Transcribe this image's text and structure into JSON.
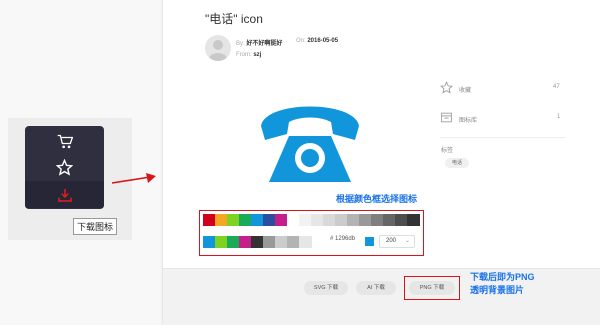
{
  "left": {
    "download_label": "下载图标"
  },
  "icon": {
    "title": "\"电话\" icon",
    "by_label": "By:",
    "author": "好不好啊挺好",
    "on_label": "On:",
    "date": "2016-05-05",
    "from_label": "From:",
    "from_value": "szj",
    "color": "#1296db"
  },
  "annotations": {
    "color_pick": "根据颜色框选择图标",
    "png_line1": "下载后即为PNG",
    "png_line2": "透明背景图片"
  },
  "sidebar": {
    "favorites_label": "收藏",
    "favorites_count": "47",
    "library_label": "图标库",
    "library_count": "1",
    "tags_label": "标签",
    "tag": "电话"
  },
  "palette": {
    "row1": [
      "#d0021b",
      "#f5a623",
      "#7ed321",
      "#1aab5a",
      "#1296db",
      "#2a4fa0",
      "#c51f8a",
      "#ffffff",
      "#f2f2f2",
      "#e6e6e6",
      "#d9d9d9",
      "#cccccc",
      "#b3b3b3",
      "#999999",
      "#7f7f7f",
      "#666666",
      "#4d4d4d",
      "#333333"
    ],
    "row2": [
      "#1296db",
      "#7ed321",
      "#1aab5a",
      "#c51f8a",
      "#333333",
      "#999999",
      "#cccccc",
      "#b3b3b3",
      "#e6e6e6"
    ],
    "hex_prefix": "#",
    "hex_value": "1296db",
    "size_value": "200"
  },
  "buttons": {
    "svg": "SVG 下载",
    "ai": "AI 下载",
    "png": "PNG 下载"
  },
  "colors": {
    "accent_red": "#d9141b",
    "annotation_blue": "#1a73e8",
    "menu_dark": "#2f2f3f"
  }
}
